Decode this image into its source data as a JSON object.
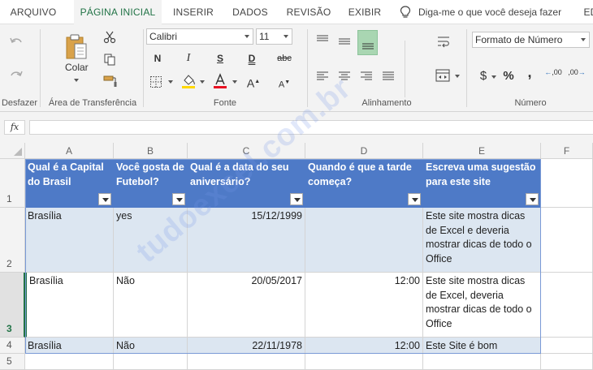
{
  "tabs": [
    {
      "label": "ARQUIVO",
      "active": false
    },
    {
      "label": "PÁGINA INICIAL",
      "active": true
    },
    {
      "label": "INSERIR",
      "active": false
    },
    {
      "label": "DADOS",
      "active": false
    },
    {
      "label": "REVISÃO",
      "active": false
    },
    {
      "label": "EXIBIR",
      "active": false
    },
    {
      "label": "ED",
      "active": false
    }
  ],
  "tell_me": {
    "text": "Diga-me o que você deseja fazer",
    "icon": "lightbulb-icon"
  },
  "ribbon": {
    "groups": {
      "undo": "Desfazer",
      "clipboard": "Área de Transferência",
      "font": "Fonte",
      "alignment": "Alinhamento",
      "number": "Número"
    },
    "paste_label": "Colar",
    "font_name": "Calibri",
    "font_size": "11",
    "bold": "N",
    "italic": "I",
    "underline": "S",
    "double_underline": "D",
    "strike": "abc",
    "grow_font": "A",
    "shrink_font": "A",
    "number_format": "Formato de Número",
    "currency": "$",
    "percent": "%",
    "comma": ",",
    "inc_decimal": ",00",
    "dec_decimal": ",00",
    "colors": {
      "accent": "#217346",
      "fill_color": "#ffd800",
      "font_color": "#e81123"
    }
  },
  "formula_bar": {
    "fx": "fx",
    "value": ""
  },
  "columns": [
    "A",
    "B",
    "C",
    "D",
    "E",
    "F"
  ],
  "rows": [
    "1",
    "2",
    "3",
    "4",
    "5"
  ],
  "table": {
    "headers": [
      "Qual é a Capital do Brasil",
      "Você gosta de Futebol?",
      "Qual é a data do seu aniversário?",
      "Quando é que a tarde começa?",
      "Escreva uma sugestão para este site"
    ],
    "rows": [
      [
        "Brasília",
        "yes",
        "15/12/1999",
        "",
        "Este site mostra dicas de Excel e deveria mostrar dicas de todo o Office"
      ],
      [
        "Brasília",
        "Não",
        "20/05/2017",
        "12:00",
        "Este site mostra dicas de Excel, deveria mostrar dicas de todo o Office"
      ],
      [
        "Brasília",
        "Não",
        "22/11/1978",
        "12:00",
        "Este Site é bom"
      ]
    ],
    "header_color": "#4e7ac7",
    "band_color": "#dce6f1"
  },
  "watermark": "tudoexcel.com.br"
}
